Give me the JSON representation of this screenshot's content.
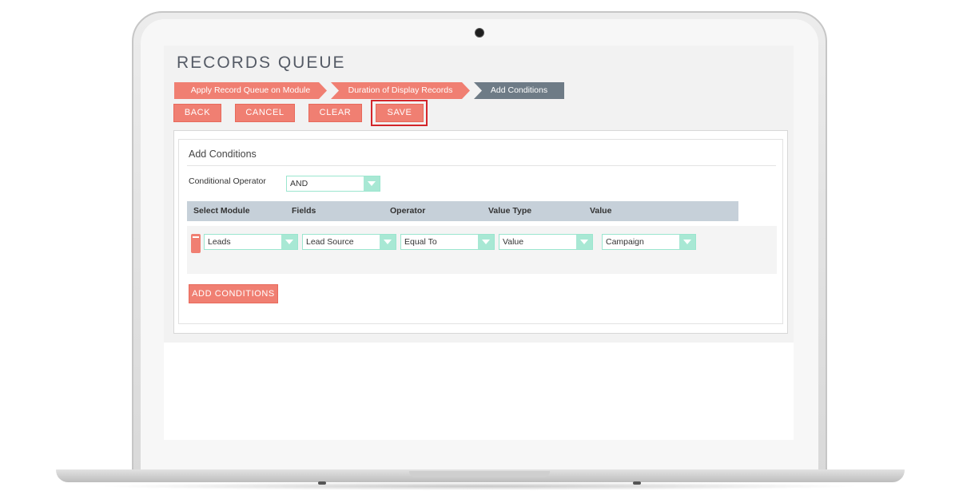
{
  "page": {
    "title": "RECORDS QUEUE"
  },
  "wizard": {
    "steps": [
      {
        "label": "Apply Record Queue on Module",
        "state": "completed"
      },
      {
        "label": "Duration of Display Records",
        "state": "completed"
      },
      {
        "label": "Add Conditions",
        "state": "active"
      }
    ]
  },
  "toolbar": {
    "back_label": "BACK",
    "cancel_label": "CANCEL",
    "clear_label": "CLEAR",
    "save_label": "SAVE"
  },
  "conditions": {
    "title": "Add Conditions",
    "operator_label": "Conditional Operator",
    "operator_value": "AND",
    "columns": [
      "Select Module",
      "Fields",
      "Operator",
      "Value Type",
      "Value"
    ],
    "rows": [
      {
        "module": "Leads",
        "field": "Lead Source",
        "operator": "Equal To",
        "value_type": "Value",
        "value": "Campaign"
      }
    ],
    "add_label": "ADD CONDITIONS"
  },
  "colors": {
    "accent": "#f07f72",
    "active_step": "#6e7b86",
    "select_arrow": "#a8e8d4",
    "header_bg": "#c6d0d9",
    "highlight": "#d3262b"
  }
}
